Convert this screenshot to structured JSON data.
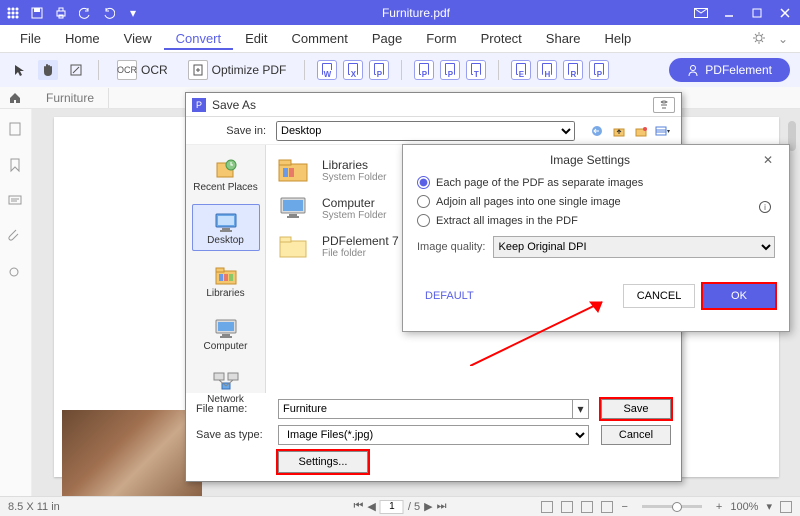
{
  "titlebar": {
    "title": "Furniture.pdf"
  },
  "menubar": {
    "items": [
      "File",
      "Home",
      "View",
      "Convert",
      "Edit",
      "Comment",
      "Page",
      "Form",
      "Protect",
      "Share",
      "Help"
    ],
    "active_index": 3
  },
  "toolbar": {
    "ocr": "OCR",
    "optimize": "Optimize PDF",
    "doc_icons": [
      "W",
      "X",
      "P",
      "P",
      "P",
      "T",
      "E",
      "H",
      "R",
      "P"
    ],
    "brand_button": "PDFelement"
  },
  "tabstrip": {
    "tab1": "Furniture"
  },
  "statusbar": {
    "dimensions": "8.5 X 11 in",
    "page_current": "1",
    "page_total": "/ 5",
    "zoom": "100%"
  },
  "saveas": {
    "title": "Save As",
    "savein_label": "Save in:",
    "savein_value": "Desktop",
    "places": [
      "Recent Places",
      "Desktop",
      "Libraries",
      "Computer",
      "Network"
    ],
    "files": [
      {
        "name": "Libraries",
        "sub": "System Folder"
      },
      {
        "name": "Computer",
        "sub": "System Folder"
      },
      {
        "name": "PDFelement 7",
        "sub": "File folder"
      }
    ],
    "filename_label": "File name:",
    "filename_value": "Furniture",
    "saveastype_label": "Save as type:",
    "saveastype_value": "Image Files(*.jpg)",
    "save_btn": "Save",
    "cancel_btn": "Cancel",
    "settings_btn": "Settings..."
  },
  "imgset": {
    "title": "Image Settings",
    "opt1": "Each page of the PDF as separate images",
    "opt2": "Adjoin all pages into one single image",
    "opt3": "Extract all images in the PDF",
    "quality_label": "Image quality:",
    "quality_value": "Keep Original DPI",
    "default_btn": "DEFAULT",
    "cancel_btn": "CANCEL",
    "ok_btn": "OK"
  }
}
